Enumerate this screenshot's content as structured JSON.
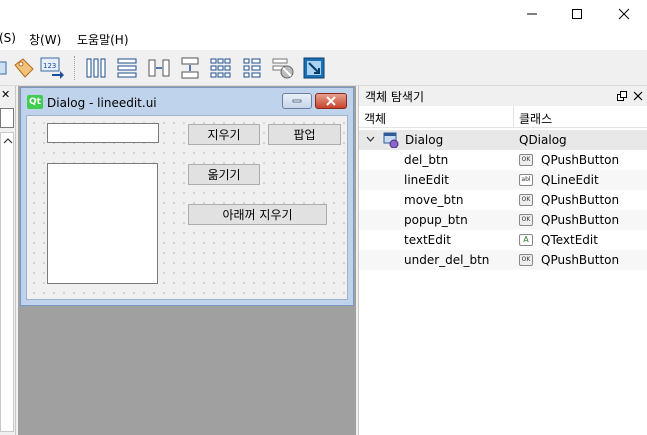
{
  "menubar": {
    "items": [
      {
        "label": "(S)",
        "x": 0
      },
      {
        "label": "창(W)"
      },
      {
        "label": "도움말(H)"
      }
    ]
  },
  "form_window": {
    "title": "Dialog - lineedit.ui",
    "widgets": {
      "del_btn_label": "지우기",
      "popup_btn_label": "팝업",
      "move_btn_label": "옮기기",
      "under_del_btn_label": "아래꺼 지우기"
    }
  },
  "object_inspector": {
    "title": "객체 탐색기",
    "columns": [
      "객체",
      "클래스"
    ],
    "root": {
      "name": "Dialog",
      "class": "QDialog"
    },
    "children": [
      {
        "name": "del_btn",
        "class": "QPushButton",
        "icon": "push-button-icon"
      },
      {
        "name": "lineEdit",
        "class": "QLineEdit",
        "icon": "line-edit-icon"
      },
      {
        "name": "move_btn",
        "class": "QPushButton",
        "icon": "push-button-icon"
      },
      {
        "name": "popup_btn",
        "class": "QPushButton",
        "icon": "push-button-icon"
      },
      {
        "name": "textEdit",
        "class": "QTextEdit",
        "icon": "text-edit-icon"
      },
      {
        "name": "under_del_btn",
        "class": "QPushButton",
        "icon": "push-button-icon"
      }
    ]
  },
  "colors": {
    "selected_row": "#e8e8e8",
    "qt_green": "#41cd52",
    "mdi_background": "#a0a0a0"
  }
}
